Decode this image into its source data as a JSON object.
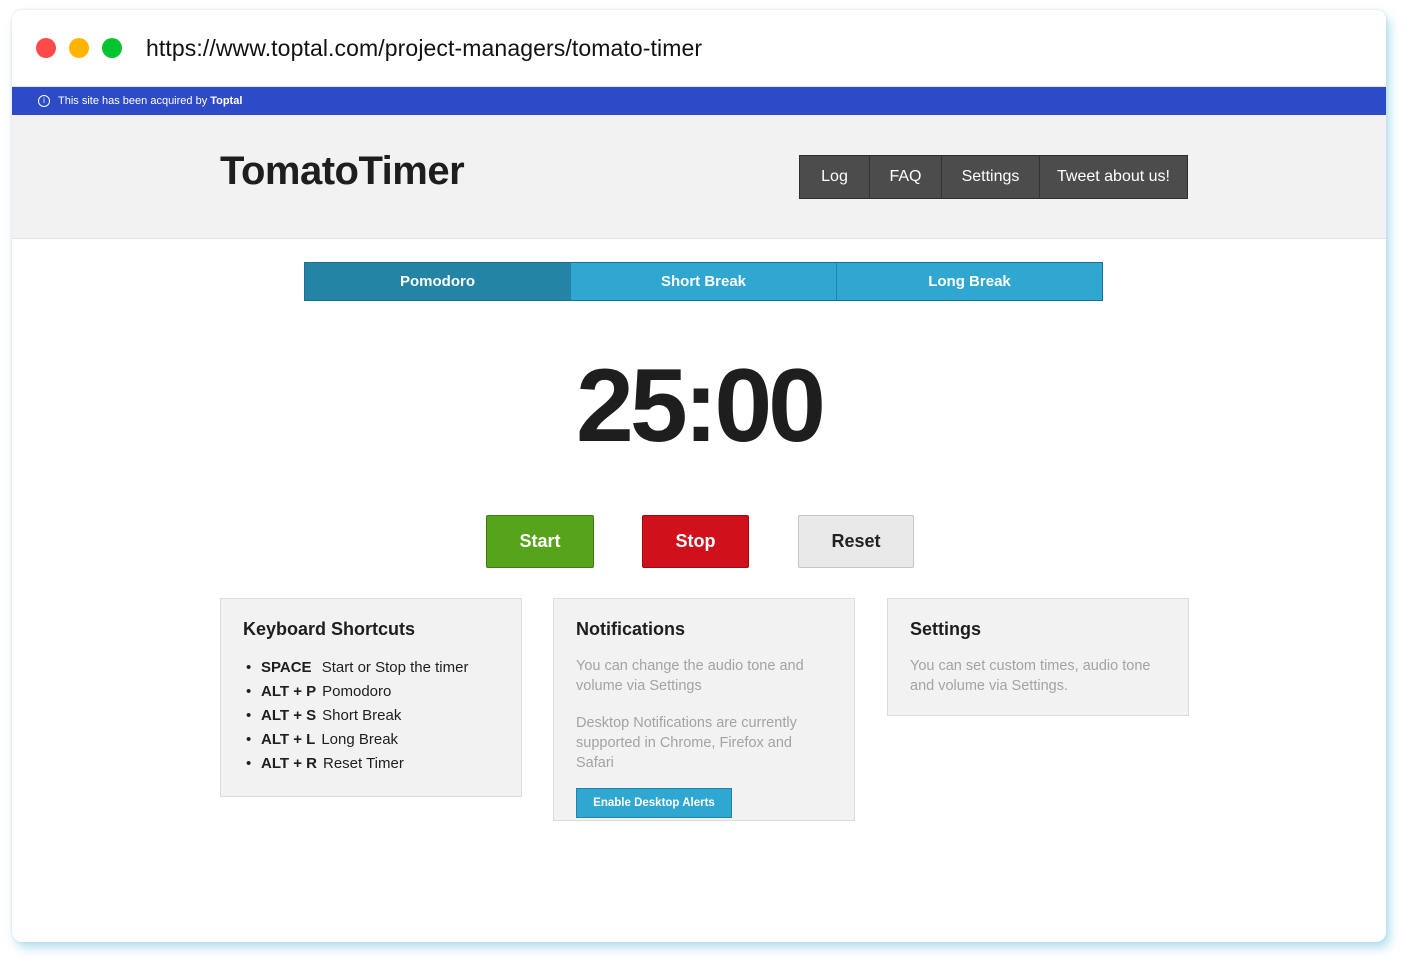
{
  "browser": {
    "url": "https://www.toptal.com/project-managers/tomato-timer"
  },
  "banner": {
    "text": "This site has been acquired by",
    "brand": "Toptal"
  },
  "header": {
    "logo": "TomatoTimer",
    "nav": {
      "log": "Log",
      "faq": "FAQ",
      "settings": "Settings",
      "tweet": "Tweet about us!"
    }
  },
  "tabs": {
    "pomodoro": "Pomodoro",
    "short_break": "Short Break",
    "long_break": "Long Break",
    "active": "pomodoro"
  },
  "timer": {
    "display": "25:00"
  },
  "controls": {
    "start": "Start",
    "stop": "Stop",
    "reset": "Reset"
  },
  "shortcuts": {
    "title": "Keyboard Shortcuts",
    "items": [
      {
        "key": "SPACE",
        "action": "Start or Stop the timer"
      },
      {
        "key": "ALT + P",
        "action": "Pomodoro"
      },
      {
        "key": "ALT + S",
        "action": "Short Break"
      },
      {
        "key": "ALT + L",
        "action": "Long Break"
      },
      {
        "key": "ALT + R",
        "action": "Reset Timer"
      }
    ]
  },
  "notifications": {
    "title": "Notifications",
    "text1": "You can change the audio tone and volume via Settings",
    "text2": "Desktop Notifications are currently supported in Chrome, Firefox and Safari",
    "button": "Enable Desktop Alerts"
  },
  "settings_box": {
    "title": "Settings",
    "text": "You can set custom times, audio tone and volume via Settings."
  },
  "colors": {
    "banner": "#2d4bc6",
    "tab": "#2fa7d0",
    "tab_active": "#2384a6",
    "start": "#56a31c",
    "stop": "#d0101a",
    "reset": "#e9e9e9"
  }
}
